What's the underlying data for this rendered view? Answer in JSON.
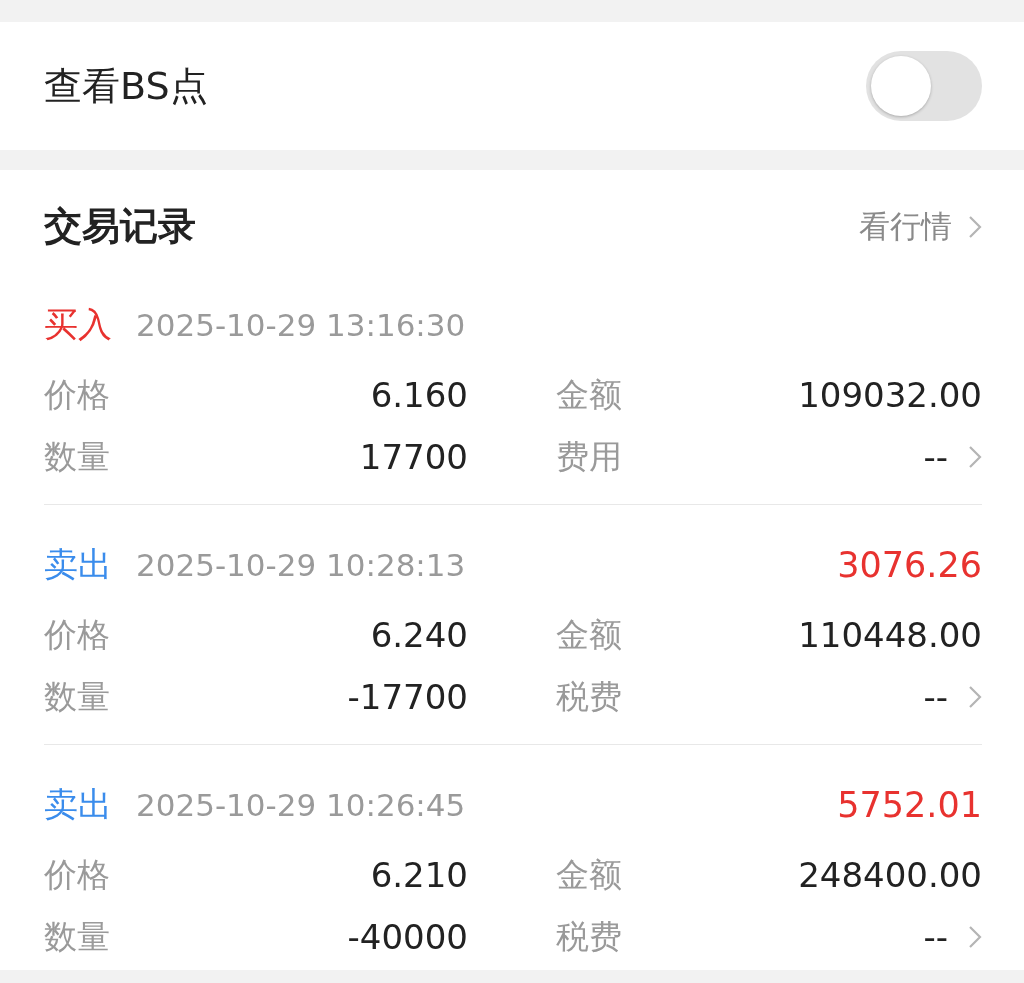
{
  "bs_setting": {
    "label": "查看BS点",
    "on": false
  },
  "trades": {
    "title": "交易记录",
    "link": "看行情",
    "records": [
      {
        "kind": "buy",
        "type": "买入",
        "time": "2025-10-29 13:16:30",
        "price_label": "价格",
        "price": "6.160",
        "amount_label": "金额",
        "amount": "109032.00",
        "qty_label": "数量",
        "qty": "17700",
        "fee_label": "费用",
        "fee": "--"
      },
      {
        "kind": "sell",
        "type": "卖出",
        "time": "2025-10-29 10:28:13",
        "profit": "3076.26",
        "price_label": "价格",
        "price": "6.240",
        "amount_label": "金额",
        "amount": "110448.00",
        "qty_label": "数量",
        "qty": "-17700",
        "fee_label": "税费",
        "fee": "--"
      },
      {
        "kind": "sell",
        "type": "卖出",
        "time": "2025-10-29 10:26:45",
        "profit": "5752.01",
        "price_label": "价格",
        "price": "6.210",
        "amount_label": "金额",
        "amount": "248400.00",
        "qty_label": "数量",
        "qty": "-40000",
        "fee_label": "税费",
        "fee": "--"
      }
    ]
  }
}
